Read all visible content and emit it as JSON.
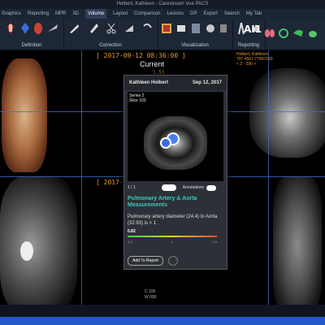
{
  "titlebar": {
    "title": "Holbert, Kathleen - Carestream Vue PACS"
  },
  "menu": [
    "Graphics",
    "Reporting",
    "MPR",
    "3D",
    "Volume",
    "Layout",
    "Comparison",
    "Lesions",
    "DP",
    "Export",
    "Search",
    "My Tab"
  ],
  "menu_active": "Volume",
  "ribbon": {
    "groups": [
      "Definition",
      "Correction",
      "Visualization",
      "Reporting"
    ],
    "ai_label": "AI1"
  },
  "viewer": {
    "timestamp1": "[ 2017-09-12 08:36:00 ]",
    "current_label": "Current",
    "current_value": "1.51",
    "timestamp2": "[ 2017-09-",
    "right_panel_info": [
      "Holbert, Kathleen",
      "797 4567 77947290",
      "< 2 - 290 >"
    ],
    "bottom_c": "C   100",
    "bottom_w": "W   600"
  },
  "popup": {
    "patient": "Kathleen Holbert",
    "date": "Sep 12, 2017",
    "series": "Series 2",
    "slice": "Slice 103",
    "page": "1 / 1",
    "annotations_label": "Annotations",
    "finding_title": "Pulmonary Artery & Aorta Measurements",
    "finding_text": "Pulmonary artery diameter (24.4) to Aorta (32.93) is < 1",
    "scale_label": "0.82",
    "scale_min": "0.3",
    "scale_mid": "1",
    "scale_max": "1.5",
    "add_report": "Add To Report"
  }
}
